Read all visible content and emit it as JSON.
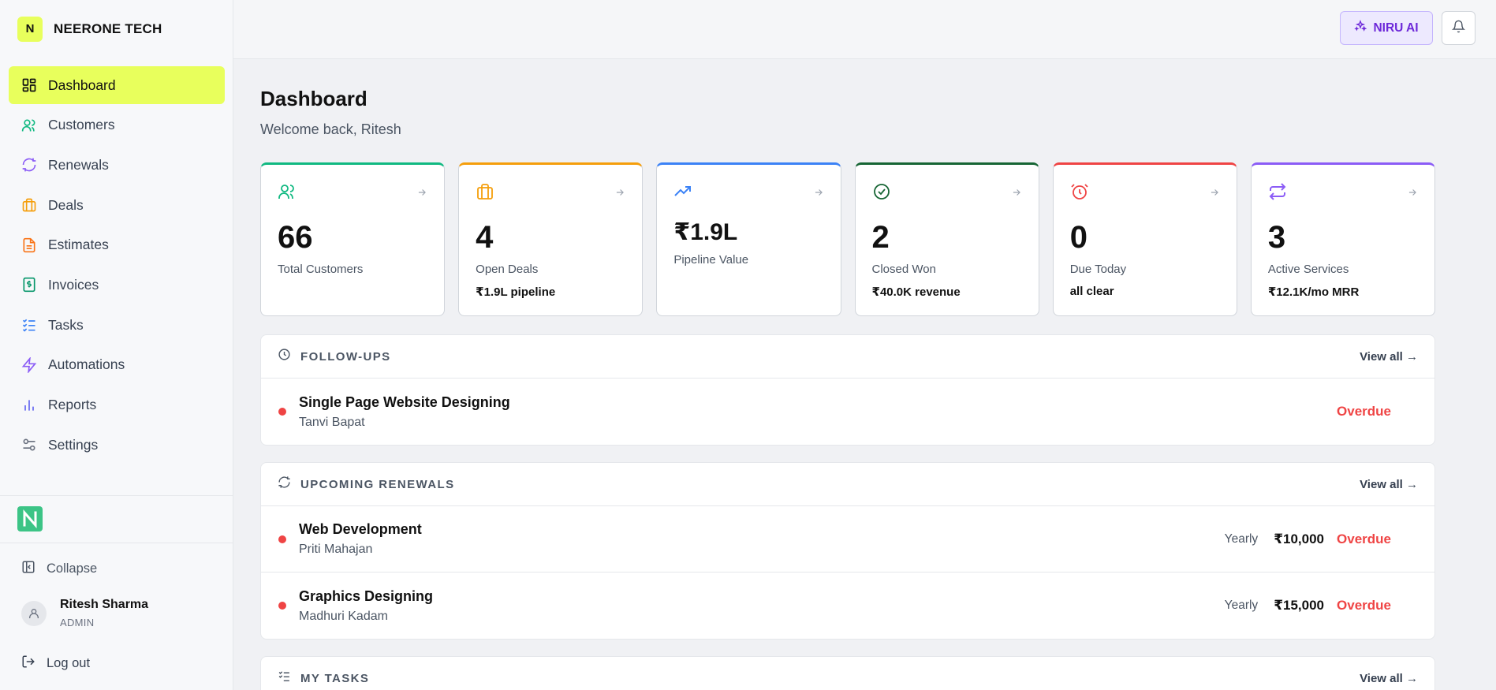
{
  "brand": {
    "logo_letter": "N",
    "name": "NEERONE TECH"
  },
  "sidebar": {
    "items": [
      {
        "label": "Dashboard",
        "icon": "dashboard-icon",
        "color": "#111111",
        "active": true
      },
      {
        "label": "Customers",
        "icon": "users-icon",
        "color": "#10b981"
      },
      {
        "label": "Renewals",
        "icon": "refresh-icon",
        "color": "#8b5cf6"
      },
      {
        "label": "Deals",
        "icon": "briefcase-icon",
        "color": "#f59e0b"
      },
      {
        "label": "Estimates",
        "icon": "file-icon",
        "color": "#f97316"
      },
      {
        "label": "Invoices",
        "icon": "invoice-icon",
        "color": "#059669"
      },
      {
        "label": "Tasks",
        "icon": "tasks-icon",
        "color": "#3b82f6"
      },
      {
        "label": "Automations",
        "icon": "zap-icon",
        "color": "#8b5cf6"
      },
      {
        "label": "Reports",
        "icon": "bar-chart-icon",
        "color": "#6366f1"
      },
      {
        "label": "Settings",
        "icon": "sliders-icon",
        "color": "#6b7280"
      }
    ],
    "collapse_label": "Collapse",
    "user": {
      "name": "Ritesh Sharma",
      "role": "ADMIN"
    },
    "logout_label": "Log out"
  },
  "topbar": {
    "ai_label": "NIRU AI"
  },
  "main": {
    "title": "Dashboard",
    "subtitle": "Welcome back, Ritesh",
    "stats": [
      {
        "value": "66",
        "label": "Total Customers",
        "sub": "",
        "color": "#10b981",
        "icon": "users-icon"
      },
      {
        "value": "4",
        "label": "Open Deals",
        "sub": "₹1.9L pipeline",
        "color": "#f59e0b",
        "icon": "briefcase-icon"
      },
      {
        "value": "₹1.9L",
        "label": "Pipeline Value",
        "sub": "",
        "color": "#3b82f6",
        "icon": "trending-up-icon"
      },
      {
        "value": "2",
        "label": "Closed Won",
        "sub": "₹40.0K revenue",
        "color": "#166534",
        "icon": "check-circle-icon"
      },
      {
        "value": "0",
        "label": "Due Today",
        "sub": "all clear",
        "color": "#ef4444",
        "icon": "alarm-icon"
      },
      {
        "value": "3",
        "label": "Active Services",
        "sub": "₹12.1K/mo MRR",
        "color": "#8b5cf6",
        "icon": "repeat-icon"
      }
    ],
    "followups": {
      "title": "FOLLOW-UPS",
      "view_all": "View all →",
      "rows": [
        {
          "title": "Single Page Website Designing",
          "sub": "Tanvi Bapat",
          "status": "Overdue"
        }
      ]
    },
    "renewals": {
      "title": "UPCOMING RENEWALS",
      "view_all": "View all →",
      "rows": [
        {
          "title": "Web Development",
          "sub": "Priti Mahajan",
          "freq": "Yearly",
          "amount": "₹10,000",
          "status": "Overdue"
        },
        {
          "title": "Graphics Designing",
          "sub": "Madhuri Kadam",
          "freq": "Yearly",
          "amount": "₹15,000",
          "status": "Overdue"
        }
      ]
    },
    "tasks": {
      "title": "MY TASKS",
      "view_all": "View all →"
    }
  }
}
